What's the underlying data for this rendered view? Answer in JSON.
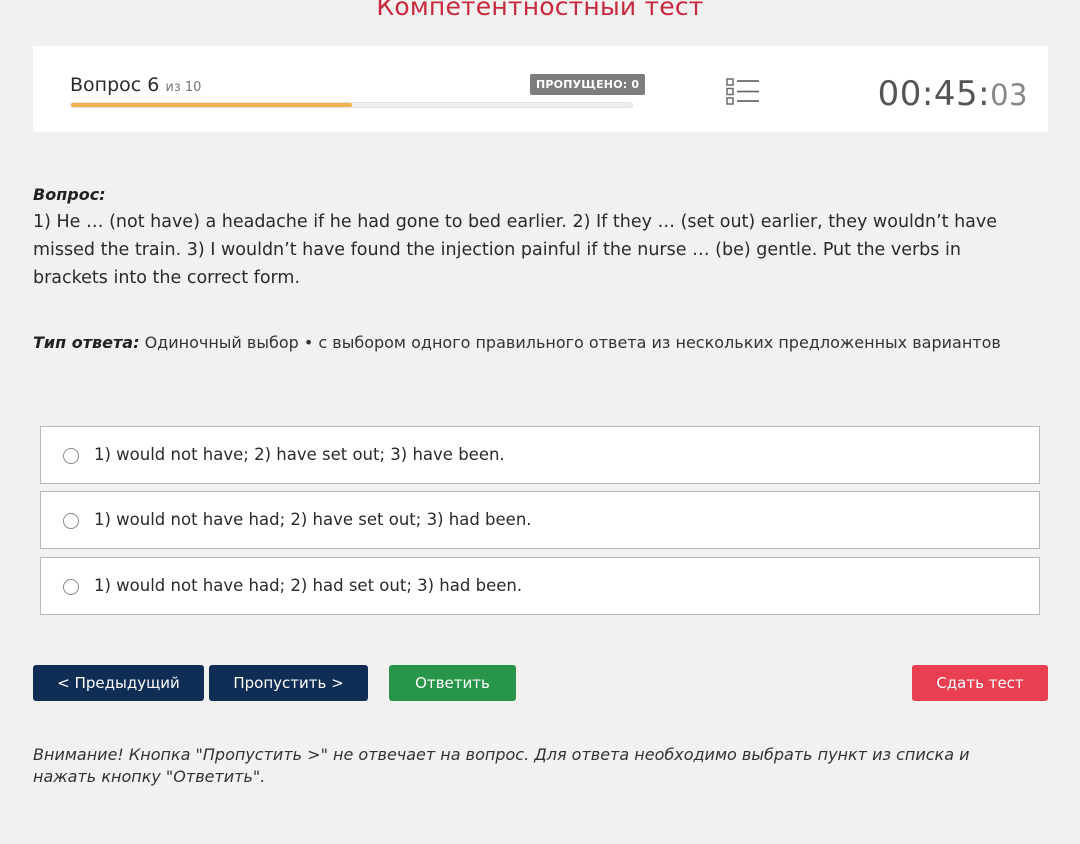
{
  "page": {
    "title": "Компетентностный тест"
  },
  "header": {
    "question_label": "Вопрос 6",
    "question_of": "из 10",
    "skipped_badge": "ПРОПУЩЕНО: 0",
    "progress_fraction": 0.5,
    "progress_color": "#efb24f",
    "list_icon": "list-icon",
    "timer_main": "00:45:",
    "timer_seconds": "03"
  },
  "question": {
    "label": "Вопрос:",
    "text": "1) He … (not have) a headache if he had gone to bed earlier. 2) If they … (set out) earlier, they wouldn’t have missed the train. 3) I wouldn’t have found the injection painful if the nurse … (be) gentle. Put the verbs in brackets into the correct form."
  },
  "answer_type": {
    "label": "Тип ответа:",
    "value": "Одиночный выбор • с выбором одного правильного ответа из нескольких предложенных вариантов"
  },
  "options": [
    {
      "text": "1) would not have; 2) have set out; 3) have been."
    },
    {
      "text": "1) would not have had; 2) have set out; 3) had been."
    },
    {
      "text": "1) would not have had; 2) had set out; 3) had been."
    }
  ],
  "buttons": {
    "prev": "< Предыдущий",
    "skip": "Пропустить >",
    "answer": "Ответить",
    "submit": "Сдать тест"
  },
  "colors": {
    "title": "#c8283e",
    "nav_buttons": "#0f2d55",
    "answer_button": "#27964a",
    "submit_button": "#e93f51"
  },
  "warning": "Внимание! Кнопка \"Пропустить >\" не отвечает на вопрос. Для ответа необходимо выбрать пункт из списка и нажать кнопку \"Ответить\"."
}
